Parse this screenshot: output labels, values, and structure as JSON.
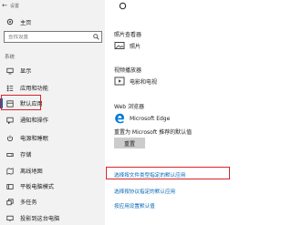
{
  "window": {
    "back_glyph": "←",
    "title": "设置"
  },
  "nav": {
    "home_label": "主页",
    "search_placeholder": "查找设置",
    "section_label": "系统",
    "items": [
      {
        "label": "显示",
        "icon": "display-icon"
      },
      {
        "label": "应用和功能",
        "icon": "apps-list-icon"
      },
      {
        "label": "默认应用",
        "icon": "default-apps-icon",
        "selected": true
      },
      {
        "label": "通知和操作",
        "icon": "notifications-icon"
      },
      {
        "label": "电源和睡眠",
        "icon": "power-icon"
      },
      {
        "label": "存储",
        "icon": "storage-icon"
      },
      {
        "label": "离线地图",
        "icon": "offline-maps-icon"
      },
      {
        "label": "平板电脑模式",
        "icon": "tablet-mode-icon"
      },
      {
        "label": "多任务",
        "icon": "multitasking-icon"
      },
      {
        "label": "投影到这台电脑",
        "icon": "project-icon"
      }
    ]
  },
  "content": {
    "photo_viewer": {
      "heading": "照片查看器",
      "app": "照片"
    },
    "video_player": {
      "heading": "视频播放器",
      "app": "电影和电视"
    },
    "web_browser": {
      "heading": "Web 浏览器",
      "app": "Microsoft Edge"
    },
    "reset": {
      "text": "重置为 Microsoft 推荐的默认值",
      "button": "重置"
    },
    "links": [
      "选择按文件类型指定的默认应用",
      "选择按协议指定的默认应用",
      "按应用设置默认值"
    ]
  },
  "colors": {
    "accent": "#0063b1",
    "highlight": "#d8232a",
    "link": "#0066b4",
    "sidebar_bg": "#f2f2f2"
  }
}
